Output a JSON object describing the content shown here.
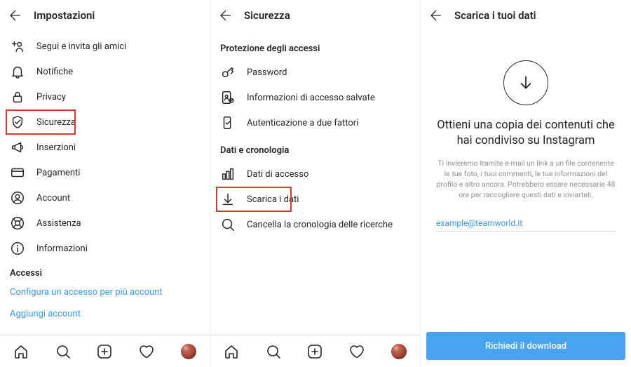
{
  "screen1": {
    "title": "Impostazioni",
    "items": [
      {
        "label": "Segui e invita gli amici"
      },
      {
        "label": "Notifiche"
      },
      {
        "label": "Privacy"
      },
      {
        "label": "Sicurezza"
      },
      {
        "label": "Inserzioni"
      },
      {
        "label": "Pagamenti"
      },
      {
        "label": "Account"
      },
      {
        "label": "Assistenza"
      },
      {
        "label": "Informazioni"
      }
    ],
    "accessHeader": "Accessi",
    "link1": "Configura un accesso per più account",
    "link2": "Aggiungi account"
  },
  "screen2": {
    "title": "Sicurezza",
    "group1": "Protezione degli accessi",
    "g1items": [
      {
        "label": "Password"
      },
      {
        "label": "Informazioni di accesso salvate"
      },
      {
        "label": "Autenticazione a due fattori"
      }
    ],
    "group2": "Dati e cronologia",
    "g2items": [
      {
        "label": "Dati di accesso"
      },
      {
        "label": "Scarica i dati"
      },
      {
        "label": "Cancella la cronologia delle ricerche"
      }
    ]
  },
  "screen3": {
    "title": "Scarica i tuoi dati",
    "heading": "Ottieni una copia dei contenuti che hai condiviso su Instagram",
    "desc": "Ti invieremo tramite e-mail un link a un file contenente le tue foto, i tuoi commenti, le tue informazioni del profilo e altro ancora. Potrebbero essere necessarie 48 ore per raccogliere questi dati e inviarteli.",
    "email": "example@teamworld.it",
    "button": "Richiedi il download"
  }
}
